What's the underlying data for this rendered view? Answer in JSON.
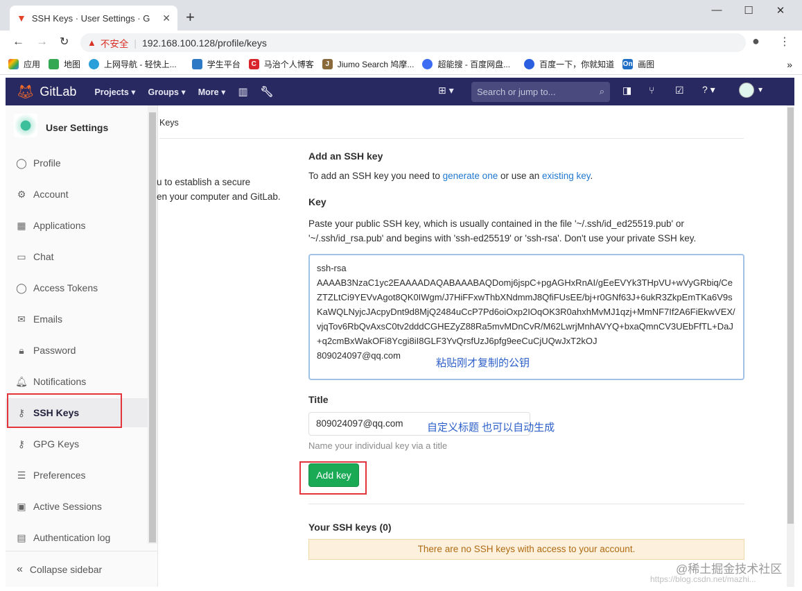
{
  "browser": {
    "tab_title": "SSH Keys · User Settings · GitL...",
    "url_warning": "不安全",
    "url": "192.168.100.128/profile/keys",
    "bookmarks": [
      "应用",
      "地图",
      "上网导航 - 轻快上...",
      "学生平台",
      "马治个人博客",
      "Jiumo Search 鸠摩...",
      "超能搜 - 百度网盘...",
      "百度一下，你就知道",
      "画图"
    ]
  },
  "gitlab_nav": {
    "brand": "GitLab",
    "items": [
      "Projects",
      "Groups",
      "More"
    ],
    "search_placeholder": "Search or jump to..."
  },
  "sidebar": {
    "header": "User Settings",
    "items": [
      {
        "label": "Profile",
        "icon": "user-icon"
      },
      {
        "label": "Account",
        "icon": "account-icon"
      },
      {
        "label": "Applications",
        "icon": "grid-icon"
      },
      {
        "label": "Chat",
        "icon": "chat-icon"
      },
      {
        "label": "Access Tokens",
        "icon": "token-icon"
      },
      {
        "label": "Emails",
        "icon": "mail-icon"
      },
      {
        "label": "Password",
        "icon": "lock-icon"
      },
      {
        "label": "Notifications",
        "icon": "bell-icon"
      },
      {
        "label": "SSH Keys",
        "icon": "key-icon"
      },
      {
        "label": "GPG Keys",
        "icon": "key-icon"
      },
      {
        "label": "Preferences",
        "icon": "sliders-icon"
      },
      {
        "label": "Active Sessions",
        "icon": "monitor-icon"
      },
      {
        "label": "Authentication log",
        "icon": "log-icon"
      }
    ],
    "collapse": "Collapse sidebar"
  },
  "breadcrumb": "Keys",
  "left_text": [
    "u to establish a secure",
    "en your computer and GitLab."
  ],
  "form": {
    "heading": "Add an SSH key",
    "intro_prefix": "To add an SSH key you need to ",
    "link1": "generate one",
    "intro_mid": " or use an ",
    "link2": "existing key",
    "intro_suffix": ".",
    "key_label": "Key",
    "key_help": "Paste your public SSH key, which is usually contained in the file '~/.ssh/id_ed25519.pub' or '~/.ssh/id_rsa.pub' and begins with 'ssh-ed25519' or 'ssh-rsa'. Don't use your private SSH key.",
    "key_value": "ssh-rsa\nAAAAB3NzaC1yc2EAAAADAQABAAABAQDomj6jspC+pgAGHxRnAI/gEeEVYk3THpVU+wVyGRbiq/CeZTZLtCi9YEVvAgot8QK0IWgm/J7HiFFxwThbXNdmmJ8QfiFUsEE/bj+r0GNf63J+6ukR3ZkpEmTKa6V9sKaWQLNyjcJAcpyDnt9d8MjQ2484uCcP7Pd6oiOxp2IOqOK3R0ahxhMvMJ1qzj+MmNF7If2A6FiEkwVEX/vjqTov6RbQvAxsC0tv2dddCGHEZyZ88Ra5mvMDnCvR/M62LwrjMnhAVYQ+bxaQmnCV3UEbFfTL+DaJ+q2cmBxWakOFi8Ycgi8iI8GLF3YvQrsfUzJ6pfg9eeCuCjUQwJxT2kOJ\n809024097@qq.com",
    "title_label": "Title",
    "title_value": "809024097@qq.com",
    "title_help": "Name your individual key via a title",
    "add_button": "Add key",
    "your_keys": "Your SSH keys (0)",
    "empty_notice": "There are no SSH keys with access to your account."
  },
  "annotations": {
    "paste": "粘贴刚才复制的公钥",
    "title_hint": "自定义标题  也可以自动生成"
  },
  "watermark": "@稀土掘金技术社区",
  "watermark_url": "https://blog.csdn.net/mazhi..."
}
